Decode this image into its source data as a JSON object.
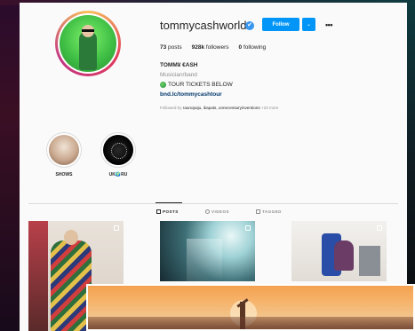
{
  "profile": {
    "username": "tommycashworld",
    "follow_label": "Follow",
    "dropdown_glyph": "⌄",
    "options_glyph": "•••",
    "verified_glyph": "✔"
  },
  "stats": {
    "posts_count": "73",
    "posts_label": "posts",
    "followers_count": "928k",
    "followers_label": "followers",
    "following_count": "0",
    "following_label": "following"
  },
  "bio": {
    "full_name": "TOMM¥ €ASH",
    "category": "Musician/band",
    "line": "TOUR TICKETS BELOW",
    "link": "bnd.lc/tommycashtour",
    "followed_by_prefix": "Followed by",
    "followed_by_names": "raunopaju, ikapats, unnecessaryinventions",
    "followed_by_more": "+23 more"
  },
  "highlights": [
    {
      "label": "SHOWS"
    },
    {
      "label": "UK🌍RU"
    }
  ],
  "tabs": [
    {
      "label": "POSTS",
      "active": true
    },
    {
      "label": "VIDEOS",
      "active": false
    },
    {
      "label": "TAGGED",
      "active": false
    }
  ],
  "colors": {
    "accent": "#0095f6",
    "verified": "#3897f0",
    "link": "#00376b",
    "muted": "#8e8e8e"
  }
}
